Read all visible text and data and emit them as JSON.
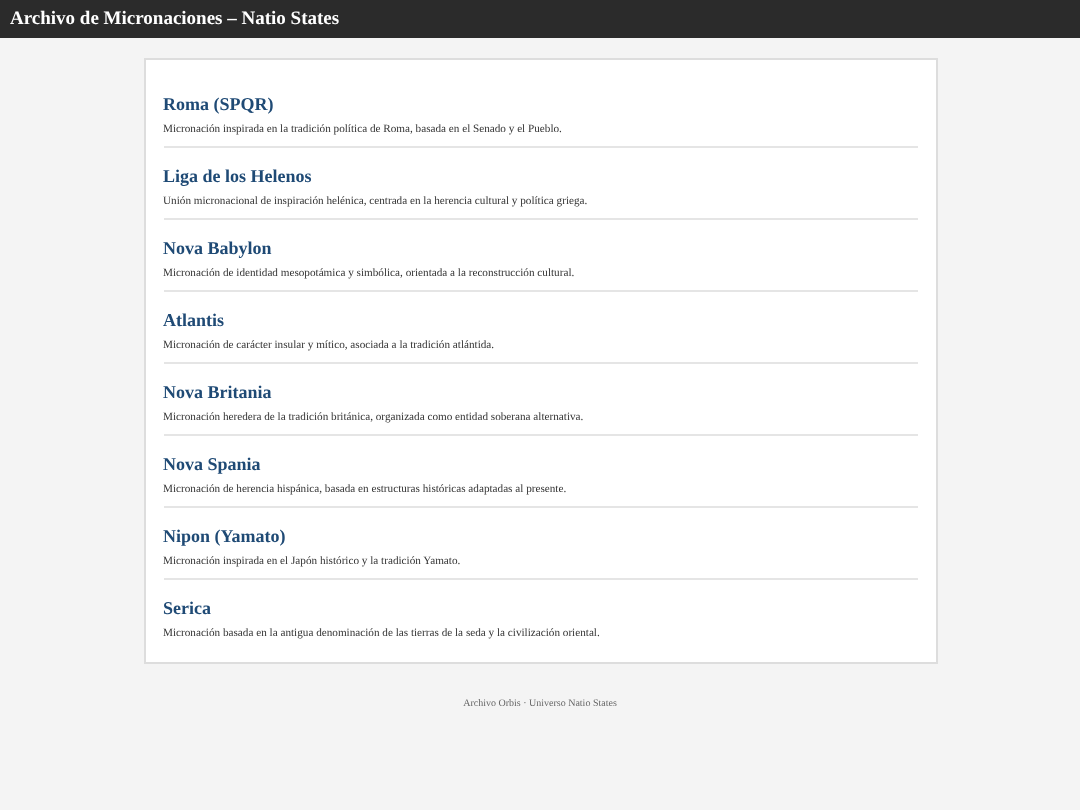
{
  "header": {
    "title": "Archivo de Micronaciones – Natio States"
  },
  "entries": [
    {
      "name": "Roma (SPQR)",
      "description": "Micronación inspirada en la tradición política de Roma, basada en el Senado y el Pueblo."
    },
    {
      "name": "Liga de los Helenos",
      "description": "Unión micronacional de inspiración helénica, centrada en la herencia cultural y política griega."
    },
    {
      "name": "Nova Babylon",
      "description": "Micronación de identidad mesopotámica y simbólica, orientada a la reconstrucción cultural."
    },
    {
      "name": "Atlantis",
      "description": "Micronación de carácter insular y mítico, asociada a la tradición atlántida."
    },
    {
      "name": "Nova Britania",
      "description": "Micronación heredera de la tradición británica, organizada como entidad soberana alternativa."
    },
    {
      "name": "Nova Spania",
      "description": "Micronación de herencia hispánica, basada en estructuras históricas adaptadas al presente."
    },
    {
      "name": "Nipon (Yamato)",
      "description": "Micronación inspirada en el Japón histórico y la tradición Yamato."
    },
    {
      "name": "Serica",
      "description": "Micronación basada en la antigua denominación de las tierras de la seda y la civilización oriental."
    }
  ],
  "footer": {
    "text": "Archivo Orbis · Universo Natio States"
  }
}
